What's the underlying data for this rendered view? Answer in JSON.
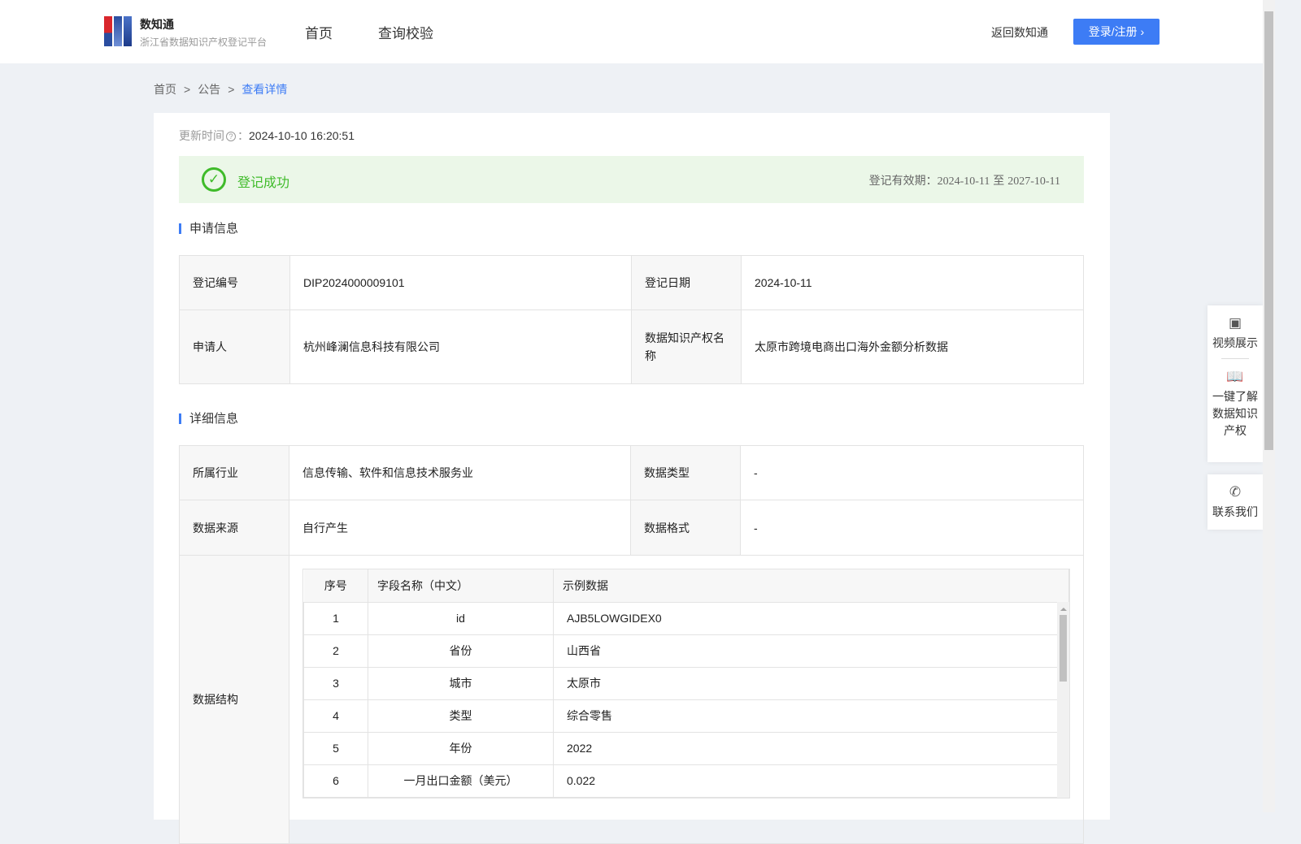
{
  "header": {
    "brand_name": "数知通",
    "brand_sub": "浙江省数据知识产权登记平台",
    "nav": [
      "首页",
      "查询校验"
    ],
    "back": "返回数知通",
    "login": "登录/注册 ›"
  },
  "breadcrumb": {
    "items": [
      "首页",
      "公告"
    ],
    "current": "查看详情",
    "sep": ">"
  },
  "update": {
    "label": "更新时间",
    "colon": "：",
    "value": "2024-10-10 16:20:51"
  },
  "status": {
    "text": "登记成功",
    "valid_label": "登记有效期：",
    "valid_from": "2024-10-11",
    "to": "至",
    "valid_to": "2027-10-11"
  },
  "apply": {
    "title": "申请信息",
    "reg_no_label": "登记编号",
    "reg_no": "DIP2024000009101",
    "reg_date_label": "登记日期",
    "reg_date": "2024-10-11",
    "applicant_label": "申请人",
    "applicant": "杭州峰澜信息科技有限公司",
    "name_label": "数据知识产权名称",
    "name": "太原市跨境电商出口海外金额分析数据"
  },
  "detail": {
    "title": "详细信息",
    "industry_label": "所属行业",
    "industry": "信息传输、软件和信息技术服务业",
    "type_label": "数据类型",
    "type": "-",
    "source_label": "数据来源",
    "source": "自行产生",
    "format_label": "数据格式",
    "format": "-",
    "structure_label": "数据结构",
    "columns": [
      "序号",
      "字段名称（中文）",
      "示例数据"
    ],
    "rows": [
      [
        "1",
        "id",
        "AJB5LOWGIDEX0"
      ],
      [
        "2",
        "省份",
        "山西省"
      ],
      [
        "3",
        "城市",
        "太原市"
      ],
      [
        "4",
        "类型",
        "综合零售"
      ],
      [
        "5",
        "年份",
        "2022"
      ],
      [
        "6",
        "一月出口金额（美元）",
        "0.022"
      ]
    ]
  },
  "side": {
    "video": "视频展示",
    "learn": [
      "一键了解",
      "数据知识",
      "产权"
    ],
    "contact": "联系我们"
  }
}
